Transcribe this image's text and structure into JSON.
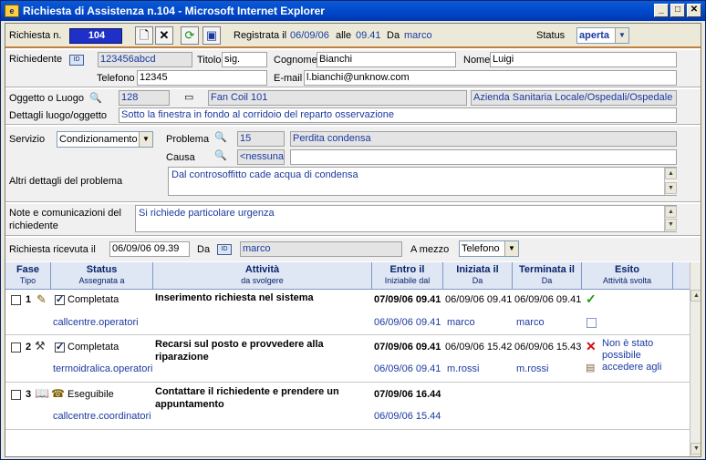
{
  "window": {
    "title": "Richiesta di Assistenza n.104 - Microsoft Internet Explorer"
  },
  "header": {
    "richiesta_label": "Richiesta n.",
    "richiesta_num": "104",
    "registrata_label": "Registrata il",
    "registrata_date": "06/09/06",
    "alle_label": "alle",
    "registrata_time": "09.41",
    "da_label": "Da",
    "registrata_user": "marco",
    "status_label": "Status",
    "status_value": "aperta"
  },
  "requester": {
    "label": "Richiedente",
    "id": "123456abcd",
    "titolo_label": "Titolo",
    "titolo": "sig.",
    "cognome_label": "Cognome",
    "cognome": "Bianchi",
    "nome_label": "Nome",
    "nome": "Luigi",
    "telefono_label": "Telefono",
    "telefono": "12345",
    "email_label": "E-mail",
    "email": "l.bianchi@unknow.com"
  },
  "location": {
    "label": "Oggetto o Luogo",
    "code": "128",
    "name": "Fan Coil 101",
    "org": "Azienda Sanitaria Locale/Ospedali/Ospedale Civ",
    "details_label": "Dettagli luogo/oggetto",
    "details": "Sotto la finestra in fondo al corridoio del reparto osservazione"
  },
  "service": {
    "servizio_label": "Servizio",
    "servizio": "Condizionamento",
    "problema_label": "Problema",
    "problema_code": "15",
    "problema": "Perdita condensa",
    "causa_label": "Causa",
    "causa": "<nessuna",
    "altri_label": "Altri dettagli del problema",
    "altri": "Dal controsoffitto cade acqua di condensa"
  },
  "notes": {
    "label": "Note e comunicazioni del richiedente",
    "text": "Si richiede particolare urgenza"
  },
  "received": {
    "label": "Richiesta ricevuta il",
    "datetime": "06/09/06 09.39",
    "da_label": "Da",
    "user": "marco",
    "mezzo_label": "A mezzo",
    "mezzo": "Telefono"
  },
  "table": {
    "headers": [
      {
        "title": "Fase",
        "sub": "Tipo"
      },
      {
        "title": "Status",
        "sub": "Assegnata a"
      },
      {
        "title": "Attività",
        "sub": "da svolgere"
      },
      {
        "title": "Entro il",
        "sub": "Iniziabile dal"
      },
      {
        "title": "Iniziata il",
        "sub": "Da"
      },
      {
        "title": "Terminata il",
        "sub": "Da"
      },
      {
        "title": "Esito",
        "sub": "Attività svolta"
      }
    ],
    "rows": [
      {
        "num": "1",
        "status": "Completata",
        "assigned": "callcentre.operatori",
        "activity": "Inserimento richiesta nel sistema",
        "entro": "07/09/06 09.41",
        "iniziabile": "06/09/06 09.41",
        "iniziata": "06/09/06 09.41",
        "iniziata_da": "marco",
        "terminata": "06/09/06 09.41",
        "terminata_da": "marco",
        "esito": "",
        "esito_color": "#1a9a1a"
      },
      {
        "num": "2",
        "status": "Completata",
        "assigned": "termoidralica.operatori",
        "activity": "Recarsi sul posto e provvedere alla riparazione",
        "entro": "07/09/06 09.41",
        "iniziabile": "06/09/06 09.41",
        "iniziata": "06/09/06 15.42",
        "iniziata_da": "m.rossi",
        "terminata": "06/09/06 15.43",
        "terminata_da": "m.rossi",
        "esito": "Non è stato possibile accedere agli",
        "esito_color": "#d01010"
      },
      {
        "num": "3",
        "status": "Eseguibile",
        "assigned": "callcentre.coordinatori",
        "activity": "Contattare il richiedente e prendere un appuntamento",
        "entro": "07/09/06 16.44",
        "iniziabile": "06/09/06 15.44",
        "iniziata": "",
        "iniziata_da": "",
        "terminata": "",
        "terminata_da": "",
        "esito": "",
        "esito_color": "#000000"
      }
    ]
  }
}
